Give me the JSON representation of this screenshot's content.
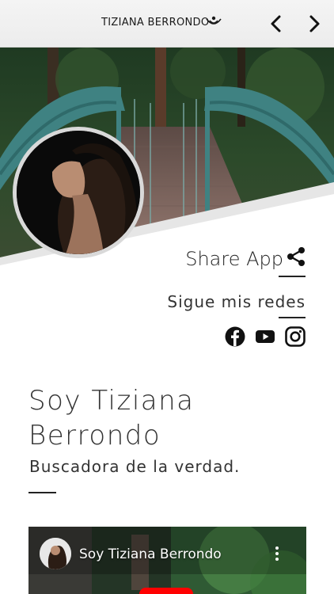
{
  "header": {
    "brand": "TIZIANA BERRONDO",
    "logo_icon": "lotus-smile-icon",
    "prev_icon": "chevron-left-icon",
    "next_icon": "chevron-right-icon"
  },
  "hero": {
    "image": "forest-bridge-photo",
    "avatar": "profile-photo"
  },
  "share": {
    "label": "Share App",
    "icon": "share-icon"
  },
  "social": {
    "label": "Sigue mis redes",
    "links": [
      "facebook-icon",
      "youtube-icon",
      "instagram-icon"
    ]
  },
  "intro": {
    "title": "Soy Tiziana Berrondo",
    "subtitle": "Buscadora de la verdad."
  },
  "video": {
    "title": "Soy Tiziana Berrondo",
    "menu_icon": "more-vertical-icon",
    "play_icon": "play-icon"
  },
  "colors": {
    "header_bg": "#f0f0f0",
    "text": "#333333",
    "youtube_red": "#ff0000"
  }
}
